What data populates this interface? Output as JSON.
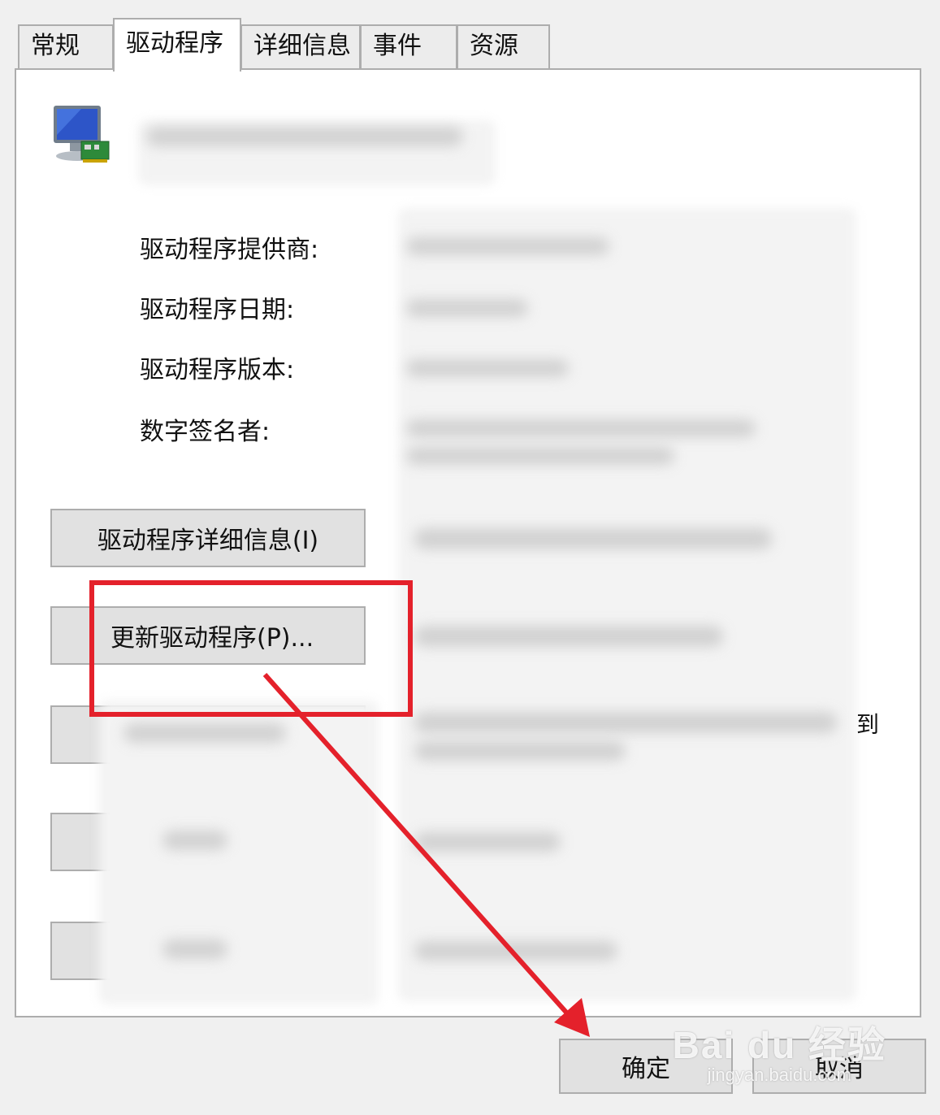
{
  "tabs": [
    {
      "label": "常规"
    },
    {
      "label": "驱动程序"
    },
    {
      "label": "详细信息"
    },
    {
      "label": "事件"
    },
    {
      "label": "资源"
    }
  ],
  "info_labels": {
    "provider": "驱动程序提供商:",
    "date": "驱动程序日期:",
    "version": "驱动程序版本:",
    "signer": "数字签名者:"
  },
  "buttons": {
    "driver_details": "驱动程序详细信息(I)",
    "update_driver": "更新驱动程序(P)..."
  },
  "partial_text": "到",
  "dialog": {
    "ok": "确定",
    "cancel": "取消"
  },
  "watermark": {
    "brand": "Bai du 经验",
    "url": "jingyan.baidu.com"
  },
  "colors": {
    "highlight": "#e4212b"
  }
}
